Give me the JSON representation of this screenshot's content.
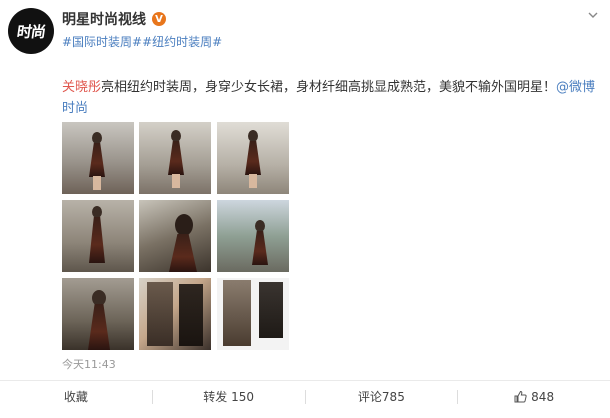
{
  "account": {
    "avatar_text": "时尚",
    "name": "明星时尚视线",
    "badge": "V"
  },
  "topics": [
    "#国际时装周#",
    "#纽约时装周#"
  ],
  "post": {
    "mention_lead": "关晓彤",
    "body": "亮相纽约时装周，身穿少女长裙，身材纤细高挑显成熟范，美貌不输外国明星！",
    "mention_tail": "@微博时尚"
  },
  "photos": [
    "photo-1",
    "photo-2",
    "photo-3",
    "photo-4",
    "photo-5",
    "photo-6",
    "photo-7",
    "photo-8",
    "photo-9"
  ],
  "timestamp": "今天11:43",
  "actions": {
    "favorite": "收藏",
    "repost": "转发 150",
    "comment": "评论785",
    "like": "848"
  },
  "icons": {
    "more": "chevron-down-icon",
    "like": "thumbs-up-icon"
  }
}
